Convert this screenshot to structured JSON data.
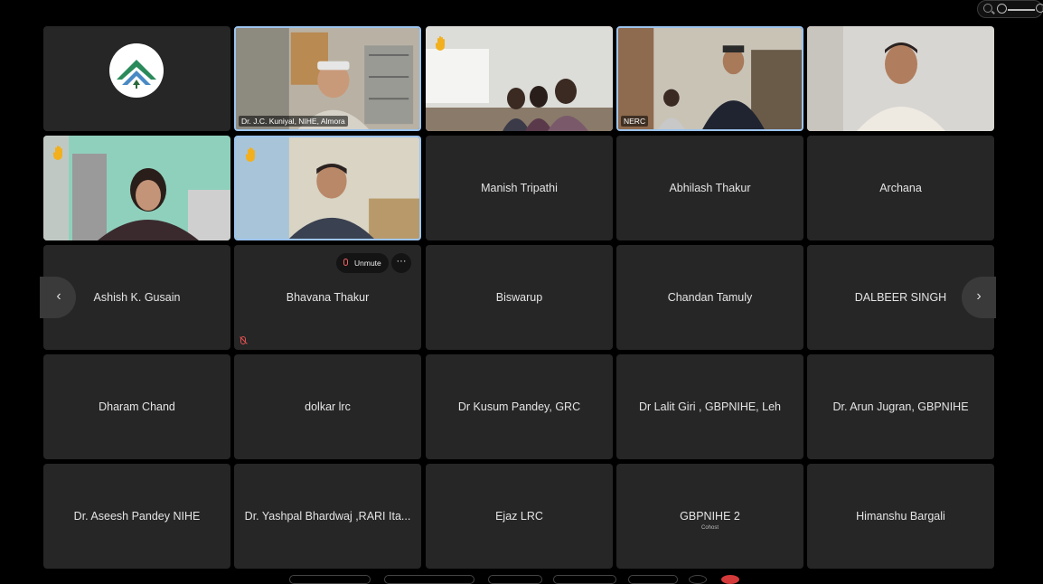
{
  "zoom": {
    "icon": "zoom-out-icon",
    "slider_icon": "zoom-slider-icon"
  },
  "tiles": [
    {
      "name": "GBPNIHE logo",
      "caption": ""
    },
    {
      "caption": "Dr. J.C. Kuniyal, NIHE, Almora"
    },
    {
      "caption": ""
    },
    {
      "caption": "NERC"
    },
    {
      "caption": ""
    },
    {
      "caption": ""
    },
    {
      "caption": ""
    },
    {
      "name": "Manish Tripathi"
    },
    {
      "name": "Abhilash Thakur"
    },
    {
      "name": "Archana"
    },
    {
      "name": "Ashish K. Gusain"
    },
    {
      "name": "Bhavana Thakur"
    },
    {
      "name": "Biswarup"
    },
    {
      "name": "Chandan Tamuly"
    },
    {
      "name": "DALBEER SINGH"
    },
    {
      "name": "Dharam Chand"
    },
    {
      "name": "dolkar lrc"
    },
    {
      "name": "Dr Kusum Pandey, GRC"
    },
    {
      "name": "Dr Lalit Giri , GBPNIHE, Leh"
    },
    {
      "name": "Dr. Arun Jugran, GBPNIHE"
    },
    {
      "name": "Dr. Aseesh Pandey NIHE"
    },
    {
      "name": "Dr. Yashpal Bhardwaj ,RARI Ita..."
    },
    {
      "name": "Ejaz LRC"
    },
    {
      "name": "GBPNIHE 2",
      "sub": "Cohost"
    },
    {
      "name": "Himanshu Bargali"
    }
  ],
  "controls": {
    "unmute_label": "Unmute",
    "more_label": "···",
    "prev_label": "‹",
    "next_label": "›"
  },
  "colors": {
    "background": "#000000",
    "tile": "#262626",
    "active_border": "#9cc4ee",
    "muted": "#e05050"
  }
}
